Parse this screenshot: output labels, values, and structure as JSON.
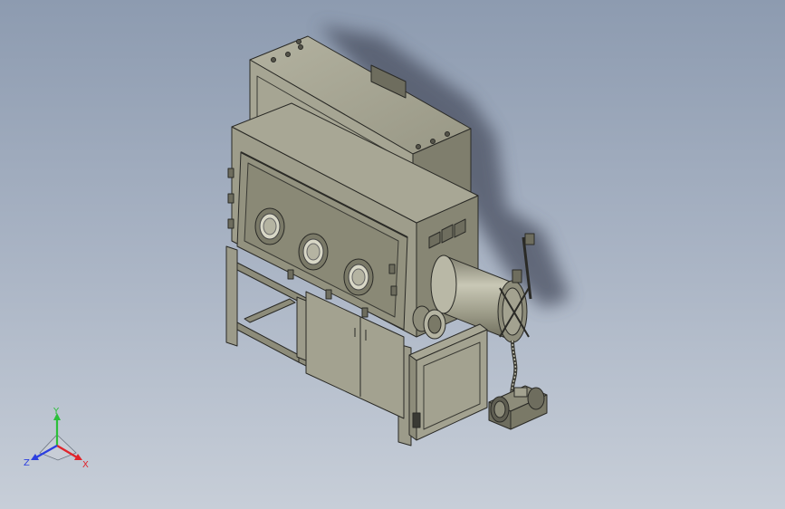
{
  "triad": {
    "x_label": "X",
    "y_label": "Y",
    "z_label": "Z",
    "colors": {
      "x": "#e0242b",
      "y": "#2bbf3a",
      "z": "#2b3fe0"
    }
  },
  "colors": {
    "background_top": "#8d9bb0",
    "background_bottom": "#c7ced8",
    "body_light": "#a9a896",
    "body_mid": "#8d8c7a",
    "body_dark": "#5f5e52",
    "edge": "#2a2a26",
    "shadow": "#4a5060"
  }
}
